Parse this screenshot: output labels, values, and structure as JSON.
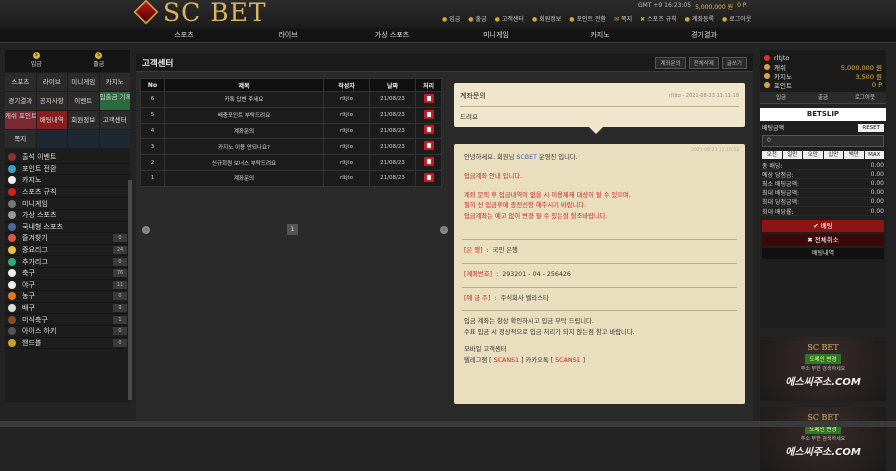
{
  "brand": {
    "name": "SC BET"
  },
  "top": {
    "links": [
      "입금",
      "출금",
      "고객센터",
      "회원정보",
      "포인트 전환",
      "쪽지",
      "스포츠 규칙",
      "계좌등록",
      "로그아웃"
    ],
    "clock": "GMT +9 16:23:05",
    "balance": "5,000,000 원",
    "points": "0 P"
  },
  "nav": [
    "스포츠",
    "라이브",
    "가상 스포츠",
    "미니게임",
    "카지노",
    "경기결과"
  ],
  "sidebar": {
    "deposit": "입금",
    "withdraw": "출금",
    "grid": [
      {
        "label": "스포츠",
        "style": ""
      },
      {
        "label": "라이브",
        "style": ""
      },
      {
        "label": "미니게임",
        "style": ""
      },
      {
        "label": "카지노",
        "style": ""
      },
      {
        "label": "경기결과",
        "style": ""
      },
      {
        "label": "공지사항",
        "style": ""
      },
      {
        "label": "이벤트",
        "style": ""
      },
      {
        "label": "입출금 기록",
        "style": "green"
      },
      {
        "label": "캐쉬 포인트",
        "style": "pink"
      },
      {
        "label": "배팅내역",
        "style": "red"
      },
      {
        "label": "회원정보",
        "style": ""
      },
      {
        "label": "고객센터",
        "style": ""
      },
      {
        "label": "쪽지",
        "style": ""
      },
      {
        "label": "",
        "style": "dark"
      },
      {
        "label": "",
        "style": "dark"
      },
      {
        "label": "",
        "style": "dark"
      }
    ],
    "items": [
      {
        "label": "출석 이벤트",
        "color": "#8e3030",
        "count": ""
      },
      {
        "label": "포인트 전환",
        "color": "#3aa0c8",
        "count": ""
      },
      {
        "label": "카지노",
        "color": "#eeeeee",
        "count": ""
      },
      {
        "label": "스포츠 규칙",
        "color": "#cc2222",
        "count": ""
      },
      {
        "label": "미니게임",
        "color": "#777777",
        "count": ""
      },
      {
        "label": "가상 스포츠",
        "color": "#999999",
        "count": ""
      },
      {
        "label": "국내형 스포츠",
        "color": "#4a6a9a",
        "count": ""
      },
      {
        "label": "즐겨찾기",
        "color": "#e05050",
        "count": "0"
      },
      {
        "label": "중요리그",
        "color": "#e8c23a",
        "count": "24"
      },
      {
        "label": "추가리그",
        "color": "#2faa7a",
        "count": "0"
      },
      {
        "label": "축구",
        "color": "#eeeeee",
        "count": "76"
      },
      {
        "label": "야구",
        "color": "#eeeeee",
        "count": "11"
      },
      {
        "label": "농구",
        "color": "#e07a20",
        "count": "0"
      },
      {
        "label": "배구",
        "color": "#dddddd",
        "count": "9"
      },
      {
        "label": "미식축구",
        "color": "#8a4a2a",
        "count": "1"
      },
      {
        "label": "아이스 하키",
        "color": "#555555",
        "count": "0"
      },
      {
        "label": "핸드볼",
        "color": "#c8a030",
        "count": "0"
      }
    ]
  },
  "main": {
    "title": "고객센터",
    "buttons": [
      "계좌문의",
      "전체삭제",
      "글쓰기"
    ],
    "columns": [
      "No",
      "제목",
      "작성자",
      "날짜",
      "처리"
    ],
    "rows": [
      [
        "6",
        "카톡 답변 주세요",
        "rltjto",
        "21/08/23"
      ],
      [
        "5",
        "배충포인트 부탁드려요",
        "rltjto",
        "21/08/23"
      ],
      [
        "4",
        "계좌문의",
        "rltjto",
        "21/08/23"
      ],
      [
        "3",
        "카지노 이용 안되나요?",
        "rltjto",
        "21/08/23"
      ],
      [
        "2",
        "신규회원 보너스 부탁드려요",
        "rltjto",
        "21/08/23"
      ],
      [
        "1",
        "계좌문의",
        "rltjto",
        "21/08/23"
      ]
    ],
    "page": "1"
  },
  "question": {
    "title": "계좌문의",
    "meta": "rltjto - 2021-08-23 11:11:18",
    "body": "드려요"
  },
  "answer": {
    "meta": "2021-08-23 11:10:53",
    "greet1": "안녕하세요. 회원님 ",
    "greet_brand": "SCBET",
    "greet2": " 운영진 입니다.",
    "notice": "입금계좌 안내 입니다.",
    "warn1": "계좌 문의 후 입금내역이 없을 시 이용제재 대상이 될 수 있으며,",
    "warn2": "필히 선 입금후에 충전신청 해주시기 바랍니다.",
    "warn3": "입금계좌는 예고 없이 변경 될 수 있는점 참조바랍니다.",
    "bank_label": "은  행",
    "bank_value": "국민 은행",
    "acct_label": "계좌번호",
    "acct_value": "293201 - 04 - 256426",
    "holder_label": "예 금 주",
    "holder_value": "주식회사 벨라스타",
    "info1": "입금 계좌는 항상 확인하시고 입금 부탁 드립니다.",
    "info2": "수표 입금 시 정상적으로 입금 처리가 되지 않는점 참고 바랍니다.",
    "cs_title": "모바일 고객센터",
    "cs_line_a": "텔레그램 [ ",
    "cs_tg": "SCANS1",
    "cs_line_b": " ] 카카오톡 [ ",
    "cs_kakao": "SCANS1",
    "cs_line_c": " ]"
  },
  "right": {
    "username": "rltjto",
    "stats": [
      {
        "label": "캐쉬",
        "value": "5,000,000 원"
      },
      {
        "label": "카지노",
        "value": "3,500 원"
      },
      {
        "label": "포인트",
        "value": "0 P"
      }
    ],
    "buttons": [
      "입금",
      "출금",
      "로그아웃"
    ],
    "slip_title": "BETSLIP",
    "amount_label": "배팅금액",
    "reset": "RESET",
    "amount_value": "0",
    "chips": [
      "오천",
      "일만",
      "오만",
      "십만",
      "백만",
      "MAX"
    ],
    "summary": [
      {
        "label": "총 배당:",
        "value": "0.00"
      },
      {
        "label": "예상 당첨금:",
        "value": "0.00"
      },
      {
        "label": "최소 배팅금액:",
        "value": "0.00"
      },
      {
        "label": "최대 배팅금액:",
        "value": "0.00"
      },
      {
        "label": "최대 당첨금액:",
        "value": "0.00"
      },
      {
        "label": "최대 배당률:",
        "value": "0.00"
      }
    ],
    "bet": "배팅",
    "cancel_all": "전체취소",
    "history": "배팅내역",
    "banner": {
      "brand": "SC BET",
      "line1": "도메인 변경",
      "line2": "주소 무한 검색하세요",
      "url": "에스씨주소.COM"
    }
  }
}
